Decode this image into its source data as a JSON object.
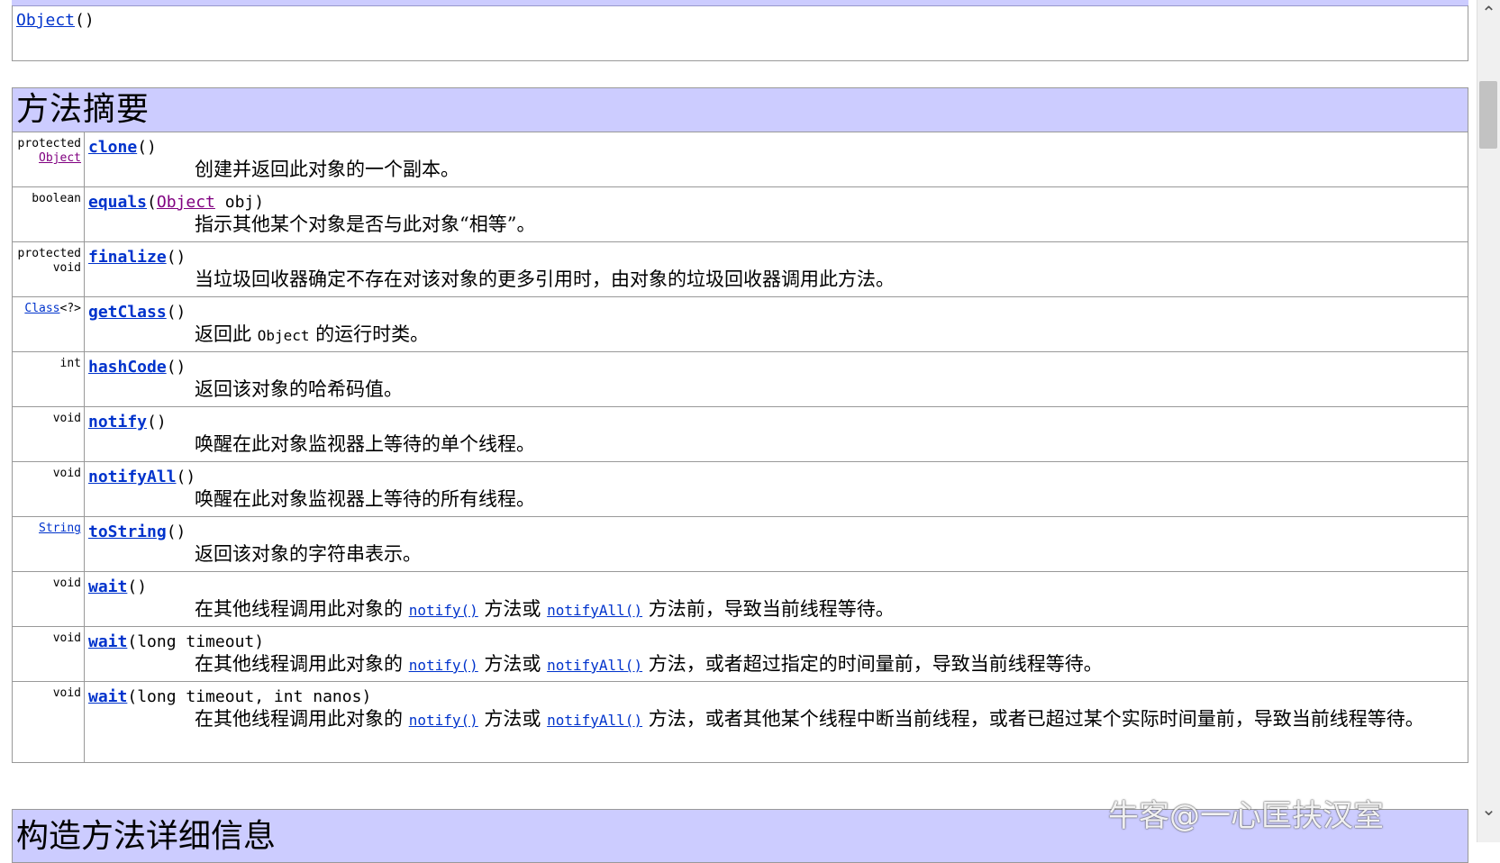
{
  "constructor": {
    "link": "Object",
    "paren": "()"
  },
  "summary": {
    "title": "方法摘要",
    "rows": [
      {
        "mod1": "protected",
        "mod2": "Object",
        "name": "clone",
        "params": "()",
        "desc": "创建并返回此对象的一个副本。"
      },
      {
        "mod1": "boolean",
        "name": "equals",
        "params_open": "(",
        "param_type": "Object",
        "params_rest": " obj)",
        "desc": "指示其他某个对象是否与此对象“相等”。"
      },
      {
        "mod1": "protected",
        "mod2": "void",
        "name": "finalize",
        "params": "()",
        "desc": "当垃圾回收器确定不存在对该对象的更多引用时，由对象的垃圾回收器调用此方法。"
      },
      {
        "mod_link": "Class",
        "mod_rest": "<?>",
        "name": "getClass",
        "params": "()",
        "desc_a": "返回此 ",
        "desc_code": "Object",
        "desc_b": " 的运行时类。"
      },
      {
        "mod1": "int",
        "name": "hashCode",
        "params": "()",
        "desc": "返回该对象的哈希码值。"
      },
      {
        "mod1": "void",
        "name": "notify",
        "params": "()",
        "desc": "唤醒在此对象监视器上等待的单个线程。"
      },
      {
        "mod1": "void",
        "name": "notifyAll",
        "params": "()",
        "desc": "唤醒在此对象监视器上等待的所有线程。"
      },
      {
        "mod_link": "String",
        "name": "toString",
        "params": "()",
        "desc": "返回该对象的字符串表示。"
      },
      {
        "mod1": "void",
        "name": "wait",
        "params": "()",
        "desc_a": "在其他线程调用此对象的 ",
        "link1": "notify()",
        "desc_b": " 方法或 ",
        "link2": "notifyAll()",
        "desc_c": " 方法前，导致当前线程等待。"
      },
      {
        "mod1": "void",
        "name": "wait",
        "params": "(long timeout)",
        "desc_a": "在其他线程调用此对象的 ",
        "link1": "notify()",
        "desc_b": " 方法或 ",
        "link2": "notifyAll()",
        "desc_c": " 方法，或者超过指定的时间量前，导致当前线程等待。"
      },
      {
        "mod1": "void",
        "name": "wait",
        "params": "(long timeout, int nanos)",
        "desc_a": "在其他线程调用此对象的 ",
        "link1": "notify()",
        "desc_b": " 方法或 ",
        "link2": "notifyAll()",
        "desc_c": " 方法，或者其他某个线程中断当前线程，或者已超过某个实际时间量前，导致当前线程等待。"
      }
    ]
  },
  "detail_header": "构造方法详细信息",
  "watermark": "牛客@一心匡扶汉室",
  "scrollbar": {
    "up_icon": "chevron-up-icon",
    "down_icon": "chevron-down-icon",
    "up_glyph": "⌃",
    "down_glyph": "⌄"
  }
}
